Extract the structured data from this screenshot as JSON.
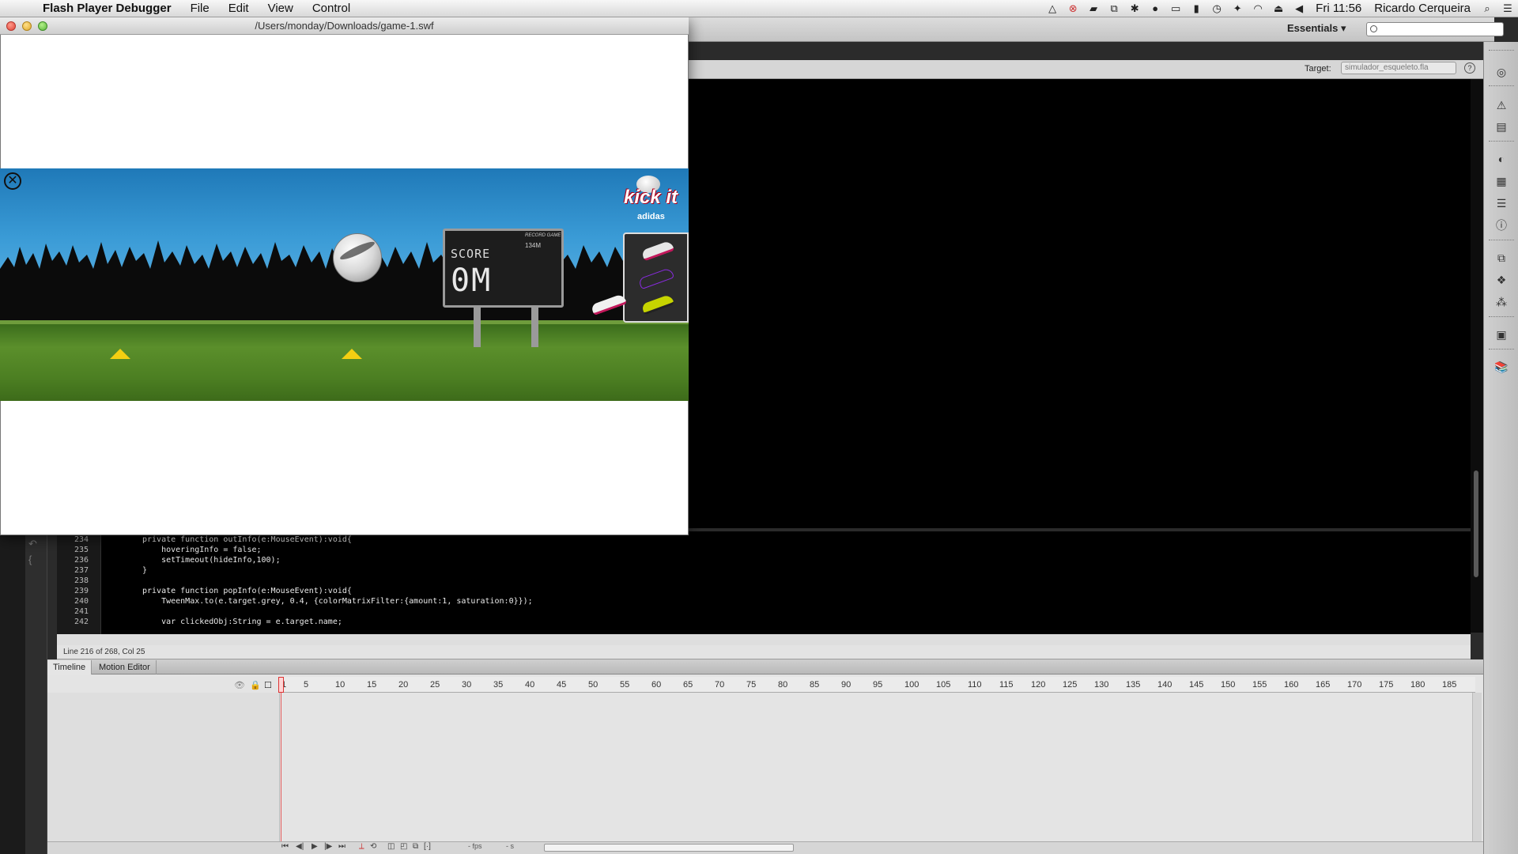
{
  "menubar": {
    "app_name": "Flash Player Debugger",
    "menus": [
      "File",
      "Edit",
      "View",
      "Control"
    ],
    "clock": "Fri 11:56",
    "user": "Ricardo Cerqueira"
  },
  "ide": {
    "workspace": "Essentials",
    "target_label": "Target:",
    "target_value": "simulador_esqueleto.fla",
    "help": "?",
    "status": "Line 216 of 268, Col 25"
  },
  "code": {
    "lines": [
      {
        "n": "234",
        "text": "private function outInfo(e:MouseEvent):void{"
      },
      {
        "n": "235",
        "text": "    hoveringInfo = false;"
      },
      {
        "n": "236",
        "text": "    setTimeout(hideInfo,100);"
      },
      {
        "n": "237",
        "text": "}"
      },
      {
        "n": "238",
        "text": ""
      },
      {
        "n": "239",
        "text": "private function popInfo(e:MouseEvent):void{"
      },
      {
        "n": "240",
        "text": "    TweenMax.to(e.target.grey, 0.4, {colorMatrixFilter:{amount:1, saturation:0}});"
      },
      {
        "n": "241",
        "text": ""
      },
      {
        "n": "242",
        "text": "    var clickedObj:String = e.target.name;"
      }
    ]
  },
  "timeline": {
    "tabs": [
      "Timeline",
      "Motion Editor"
    ],
    "frame_ticks": [
      "1",
      "5",
      "10",
      "15",
      "20",
      "25",
      "30",
      "35",
      "40",
      "45",
      "50",
      "55",
      "60",
      "65",
      "70",
      "75",
      "80",
      "85",
      "90",
      "95",
      "100",
      "105",
      "110",
      "115",
      "120",
      "125",
      "130",
      "135",
      "140",
      "145",
      "150",
      "155",
      "160",
      "165",
      "170",
      "175",
      "180",
      "185"
    ],
    "fps": "- fps",
    "seconds": "- s"
  },
  "player": {
    "title": "/Users/monday/Downloads/game-1.swf",
    "game": {
      "score_label": "SCORE",
      "score_value": "0M",
      "record_label": "RECORD GAME",
      "record_value": "134M",
      "brand_title": "kick it",
      "brand_sub": "adidas",
      "colors": {
        "sky": "#2a88c6",
        "grass": "#4c7f22",
        "cone": "#f4cf12"
      }
    }
  }
}
